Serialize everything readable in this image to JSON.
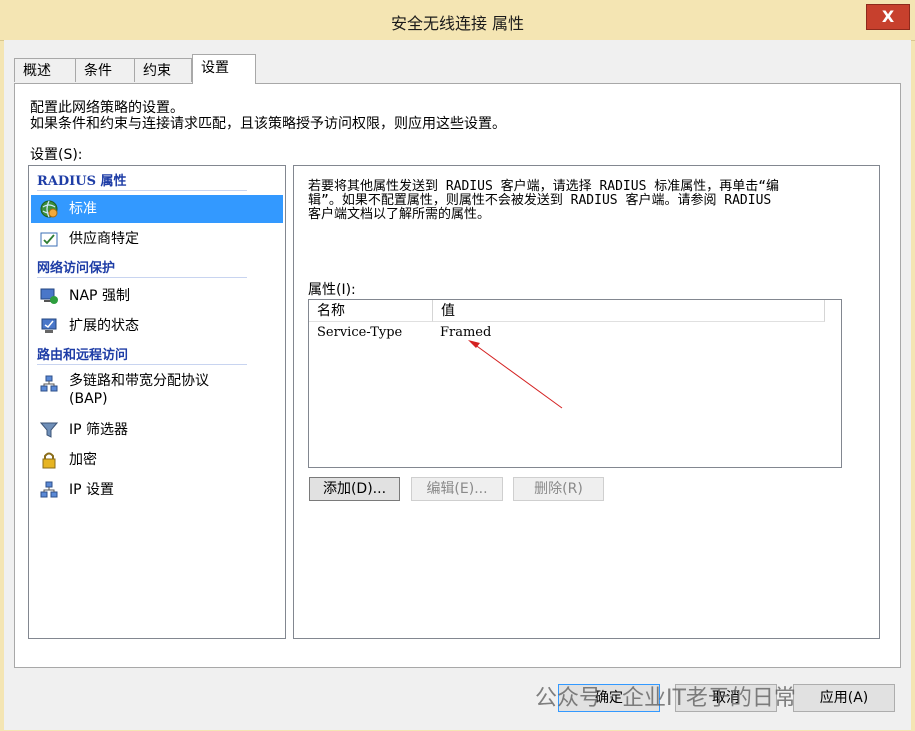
{
  "window": {
    "title": "安全无线连接 属性",
    "close_glyph": "X"
  },
  "tabs": [
    {
      "label": "概述",
      "active": false
    },
    {
      "label": "条件",
      "active": false
    },
    {
      "label": "约束",
      "active": false
    },
    {
      "label": "设置",
      "active": true
    }
  ],
  "description": {
    "line1": "配置此网络策略的设置。",
    "line2": "如果条件和约束与连接请求匹配，且该策略授予访问权限，则应用这些设置。"
  },
  "settings_label": "设置(S):",
  "left_list": {
    "sections": [
      {
        "header": "RADIUS 属性",
        "items": [
          {
            "label": "标准",
            "icon": "globe-icon",
            "selected": true
          },
          {
            "label": "供应商特定",
            "icon": "checkbox-doc-icon",
            "selected": false
          }
        ]
      },
      {
        "header": "网络访问保护",
        "items": [
          {
            "label": "NAP 强制",
            "icon": "nap-computer-icon",
            "selected": false
          },
          {
            "label": "扩展的状态",
            "icon": "monitor-icon",
            "selected": false
          }
        ]
      },
      {
        "header": "路由和远程访问",
        "items": [
          {
            "label": "多链路和带宽分配协议",
            "label2": "(BAP)",
            "icon": "network-icon",
            "selected": false
          },
          {
            "label": "IP 筛选器",
            "icon": "filter-icon",
            "selected": false
          },
          {
            "label": "加密",
            "icon": "lock-icon",
            "selected": false
          },
          {
            "label": "IP 设置",
            "icon": "network-icon",
            "selected": false
          }
        ]
      }
    ]
  },
  "right_panel": {
    "desc_line1": "若要将其他属性发送到 RADIUS 客户端，请选择 RADIUS 标准属性，再单击“编",
    "desc_line2": "辑”。如果不配置属性，则属性不会被发送到 RADIUS 客户端。请参阅 RADIUS",
    "desc_line3": "客户端文档以了解所需的属性。",
    "attributes_label": "属性(I):",
    "columns": [
      "名称",
      "值"
    ],
    "rows": [
      {
        "name": "Service-Type",
        "value": "Framed"
      }
    ],
    "buttons": {
      "add": "添加(D)...",
      "edit": "编辑(E)...",
      "delete": "删除(R)"
    }
  },
  "footer_buttons": {
    "ok": "确定",
    "cancel": "取消",
    "apply": "应用(A)"
  },
  "watermark": "公众号 · 企业IT老于的日常",
  "colors": {
    "title_bar": "#f4e5b3",
    "close_button": "#c7402d",
    "selection": "#3399ff",
    "section_header": "#1e3da6",
    "annotation_arrow": "#d42020"
  }
}
